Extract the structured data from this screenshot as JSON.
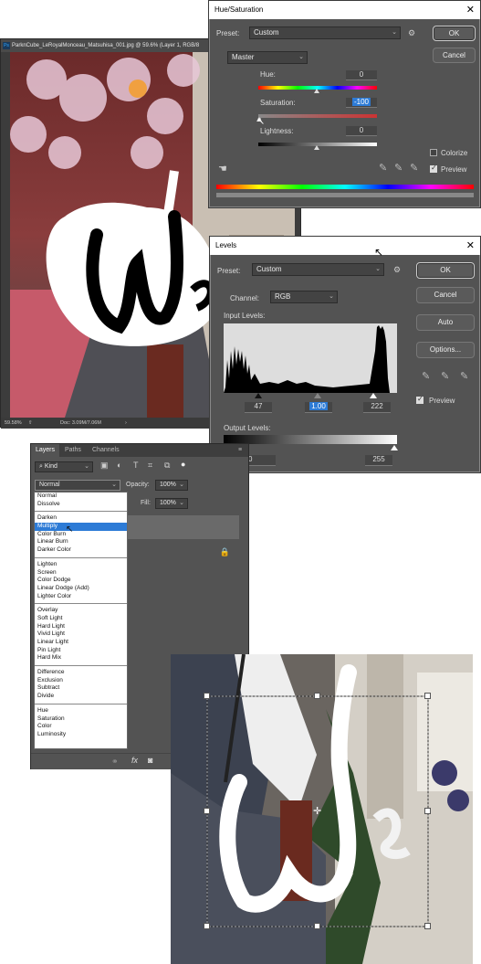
{
  "document": {
    "tab_title": "ParknCube_LeRoyalMonceau_Matsuhisa_001.jpg @ 59.6% (Layer 1, RGB/8",
    "zoom": "59.58%",
    "doc_size": "Doc: 3.09M/7.06M"
  },
  "hue_saturation": {
    "title": "Hue/Saturation",
    "preset_label": "Preset:",
    "preset_value": "Custom",
    "channel_value": "Master",
    "hue_label": "Hue:",
    "hue_value": "0",
    "saturation_label": "Saturation:",
    "saturation_value": "-100",
    "lightness_label": "Lightness:",
    "lightness_value": "0",
    "ok_label": "OK",
    "cancel_label": "Cancel",
    "colorize_label": "Colorize",
    "preview_label": "Preview",
    "colorize_checked": false,
    "preview_checked": true
  },
  "levels": {
    "title": "Levels",
    "preset_label": "Preset:",
    "preset_value": "Custom",
    "channel_label": "Channel:",
    "channel_value": "RGB",
    "input_levels_label": "Input Levels:",
    "input_black": "47",
    "input_gamma": "1.00",
    "input_white": "222",
    "output_levels_label": "Output Levels:",
    "output_black": "0",
    "output_white": "255",
    "ok_label": "OK",
    "cancel_label": "Cancel",
    "auto_label": "Auto",
    "options_label": "Options...",
    "preview_label": "Preview",
    "preview_checked": true
  },
  "layers_panel": {
    "tabs": [
      "Layers",
      "Paths",
      "Channels"
    ],
    "active_tab": "Layers",
    "filter_kind": "Kind",
    "blend_mode": "Normal",
    "opacity_label": "Opacity:",
    "opacity_value": "100%",
    "fill_label": "Fill:",
    "fill_value": "100%",
    "blend_groups": [
      [
        "Normal",
        "Dissolve"
      ],
      [
        "Darken",
        "Multiply",
        "Color Burn",
        "Linear Burn",
        "Darker Color"
      ],
      [
        "Lighten",
        "Screen",
        "Color Dodge",
        "Linear Dodge (Add)",
        "Lighter Color"
      ],
      [
        "Overlay",
        "Soft Light",
        "Hard Light",
        "Vivid Light",
        "Linear Light",
        "Pin Light",
        "Hard Mix"
      ],
      [
        "Difference",
        "Exclusion",
        "Subtract",
        "Divide"
      ],
      [
        "Hue",
        "Saturation",
        "Color",
        "Luminosity"
      ]
    ],
    "highlighted_mode": "Multiply"
  },
  "artwork": {
    "text": "We"
  }
}
